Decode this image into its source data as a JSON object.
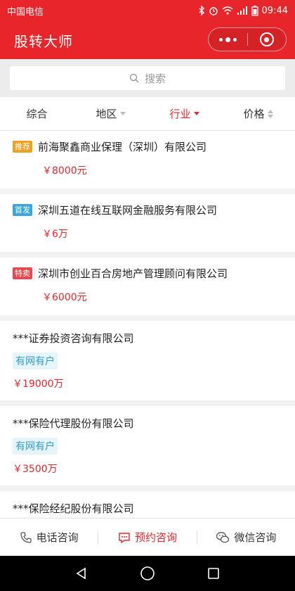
{
  "status": {
    "carrier": "中国电信",
    "time": "09:44"
  },
  "app": {
    "title": "股转大师"
  },
  "search": {
    "placeholder": "搜索"
  },
  "filters": [
    {
      "label": "综合",
      "active": false
    },
    {
      "label": "地区",
      "active": false
    },
    {
      "label": "行业",
      "active": true
    },
    {
      "label": "价格",
      "active": false
    }
  ],
  "featured": [
    {
      "tag": "推荐",
      "tag_color": "#f0a020",
      "name": "前海聚鑫商业保理（深圳）有限公司",
      "price": "￥8000元"
    },
    {
      "tag": "首发",
      "tag_color": "#3aa6db",
      "name": "深圳五道在线互联网金融服务有限公司",
      "price": "￥6万"
    },
    {
      "tag": "特卖",
      "tag_color": "#e8484d",
      "name": "深圳市创业百合房地产管理顾问有限公司",
      "price": "￥6000元"
    }
  ],
  "listings": [
    {
      "name": "***证券投资咨询有限公司",
      "badge": "有网有户",
      "price": "￥19000万"
    },
    {
      "name": "***保险代理股份有限公司",
      "badge": "有网有户",
      "price": "￥3500万"
    },
    {
      "name": "***保险经纪股份有限公司",
      "badge": "",
      "price": ""
    }
  ],
  "bottom": [
    {
      "label": "电话咨询",
      "icon": "phone-icon",
      "active": false
    },
    {
      "label": "预约咨询",
      "icon": "chat-bubble-icon",
      "active": true
    },
    {
      "label": "微信咨询",
      "icon": "wechat-icon",
      "active": false
    }
  ],
  "colors": {
    "brand": "#e8252a",
    "badge_text": "#2f9bd1",
    "badge_bg": "#e6f4fb"
  }
}
